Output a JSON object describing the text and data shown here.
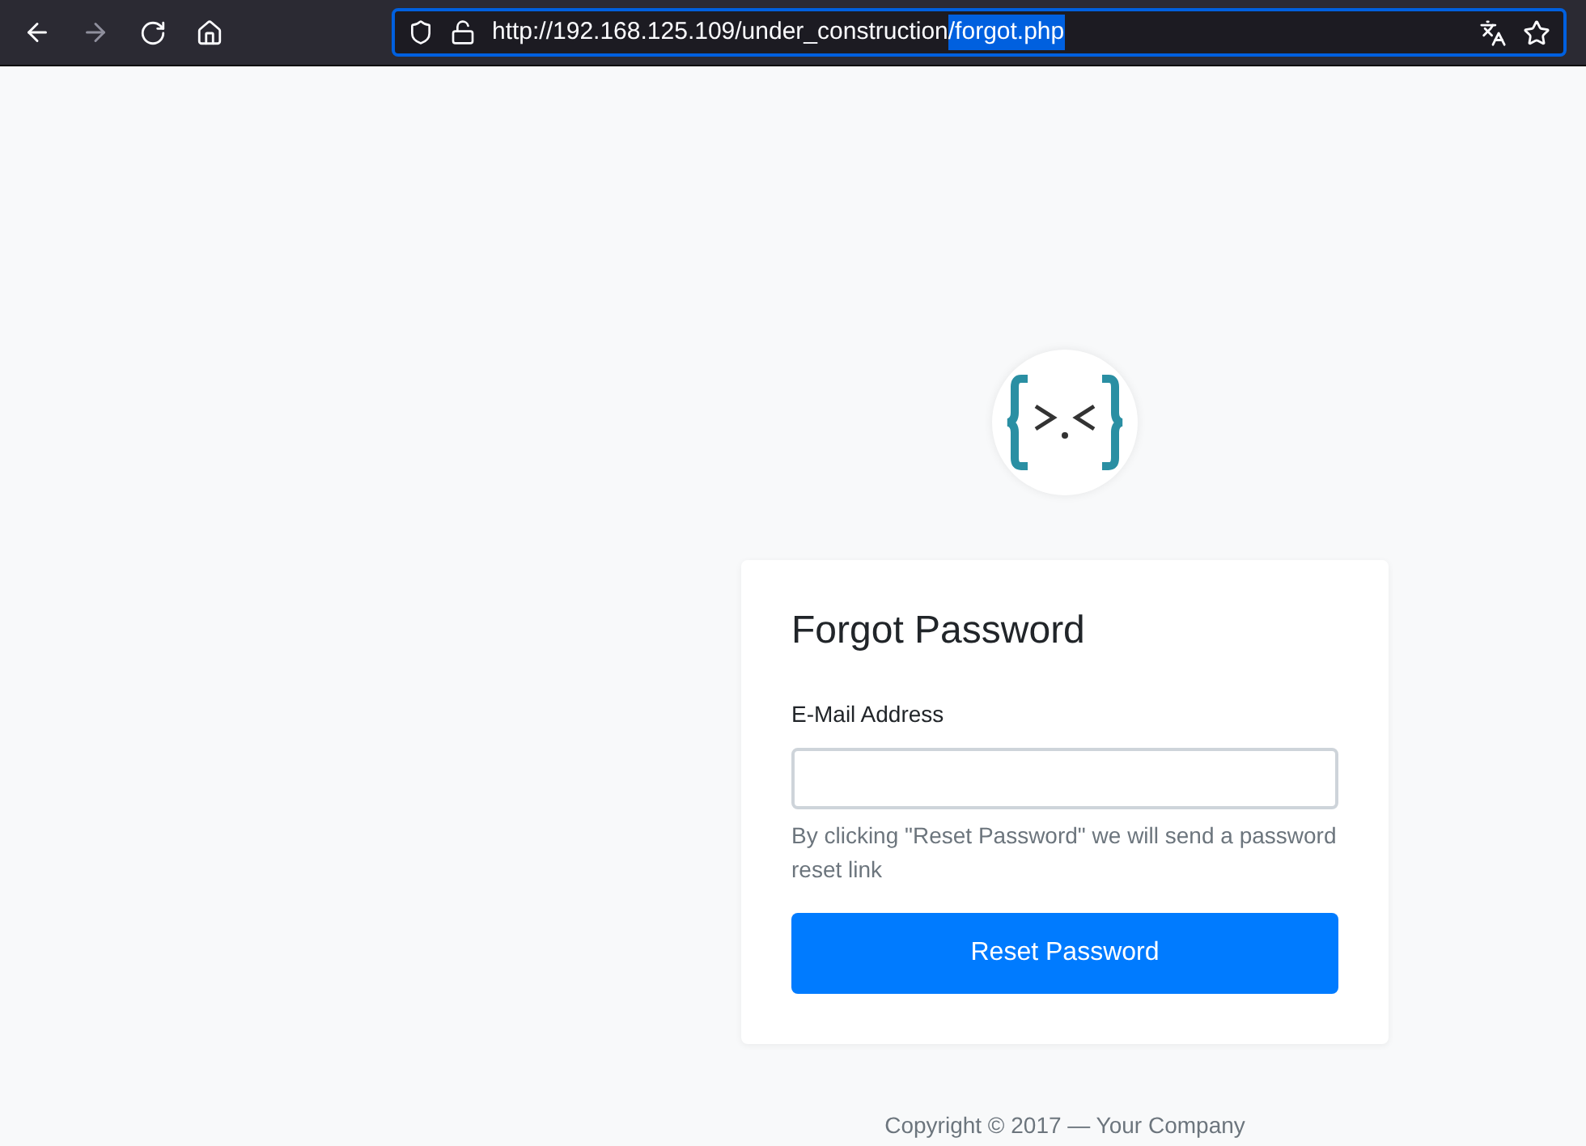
{
  "browser": {
    "url_parts": [
      {
        "text": "http://192.168.125.109/under_construction",
        "selected": false
      },
      {
        "text": "/forgot.php",
        "selected": true
      }
    ]
  },
  "card": {
    "title": "Forgot Password",
    "email_label": "E-Mail Address",
    "help_text": "By clicking \"Reset Password\" we will send a password reset link",
    "button": "Reset Password"
  },
  "footer": "Copyright © 2017 — Your Company"
}
